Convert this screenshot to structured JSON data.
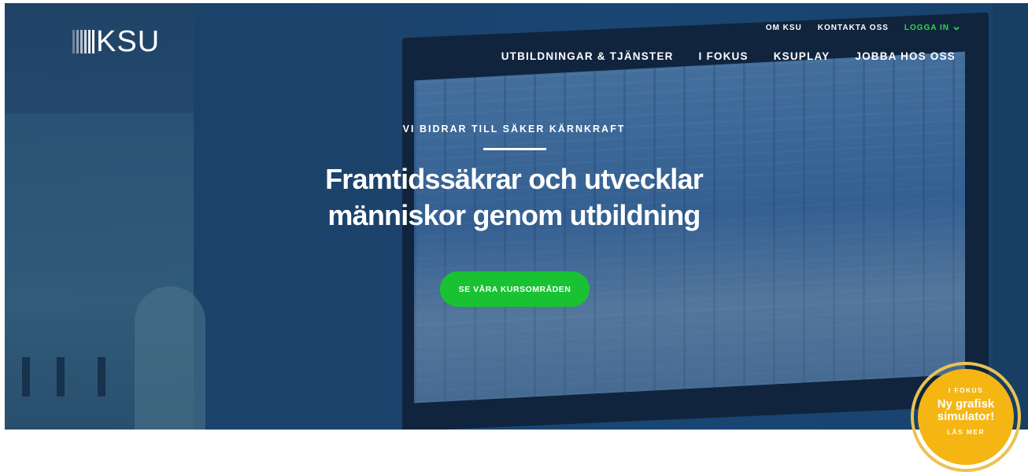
{
  "brand": {
    "logo_text": "KSU"
  },
  "top_links": {
    "about": "OM KSU",
    "contact": "KONTAKTA OSS",
    "login": "LOGGA IN"
  },
  "main_nav": {
    "item_1": "UTBILDNINGAR & TJÄNSTER",
    "item_2": "I FOKUS",
    "item_3": "KSUPLAY",
    "item_4": "JOBBA HOS OSS"
  },
  "hero": {
    "tagline": "VI BIDRAR TILL SÄKER KÄRNKRAFT",
    "headline_line_1": "Framtidssäkrar och utvecklar",
    "headline_line_2": "människor genom utbildning",
    "cta_label": "SE VÅRA KURSOMRÅDEN"
  },
  "badge": {
    "eyebrow": "I FOKUS",
    "title_line_1": "Ny grafisk",
    "title_line_2": "simulator!",
    "link": "LÄS MER"
  },
  "colors": {
    "accent_green": "#19c233",
    "login_green": "#2fd84a",
    "badge_yellow": "#f5b614",
    "badge_ring": "#e8c453",
    "hero_overlay_blue": "#1f4a73"
  },
  "icons": {
    "login_caret": "chevron-down-icon",
    "logo_mark": "bars-logo-icon"
  }
}
